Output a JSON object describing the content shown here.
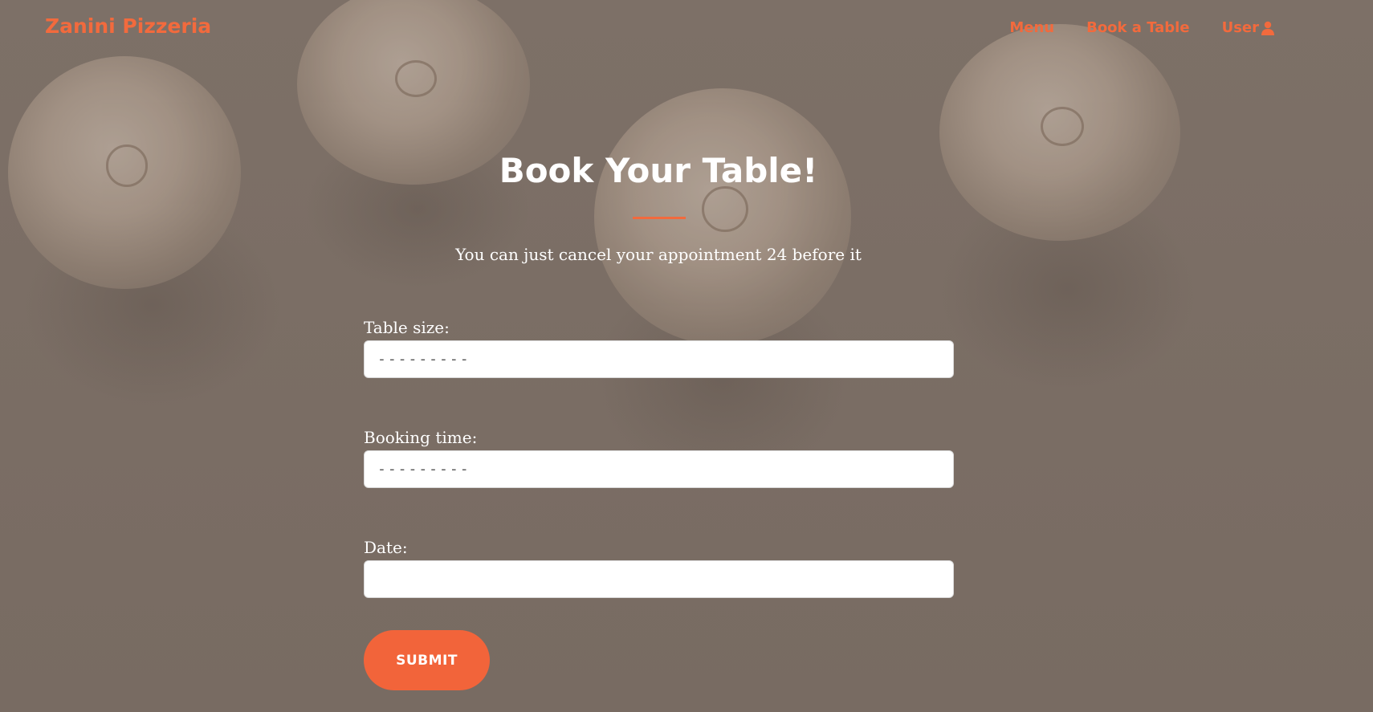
{
  "nav": {
    "brand": "Zanini Pizzeria",
    "links": [
      {
        "label": "Menu"
      },
      {
        "label": "Book a Table"
      },
      {
        "label": "User",
        "icon": "user-icon"
      }
    ]
  },
  "booking": {
    "title": "Book Your Table!",
    "subtitle": "You can just cancel your appointment 24 before it",
    "fields": [
      {
        "label": "Table size:",
        "value": "---------"
      },
      {
        "label": "Booking time:",
        "value": "---------"
      },
      {
        "label": "Date:",
        "value": ""
      }
    ],
    "submit_label": "SUBMIT"
  },
  "colors": {
    "accent": "#f26a3d",
    "background": "#7a6d64",
    "text": "#ffffff"
  }
}
